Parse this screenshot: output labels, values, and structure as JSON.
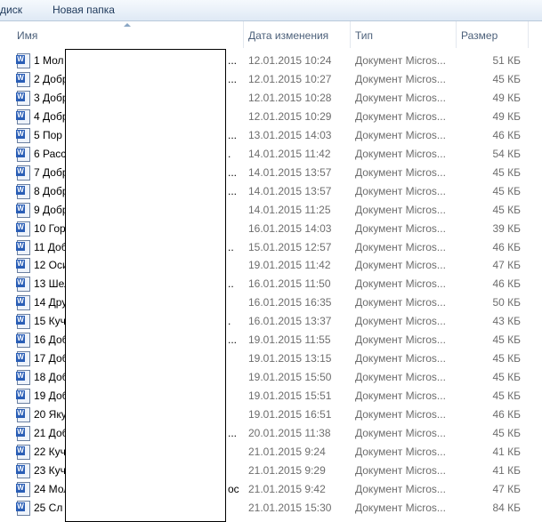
{
  "toolbar": {
    "drive_label": "диск",
    "new_folder_label": "Новая папка"
  },
  "columns": {
    "name": "Имя",
    "date": "Дата изменения",
    "type": "Тип",
    "size": "Размер"
  },
  "files": [
    {
      "name": "1 Мол",
      "suffix": "...",
      "date": "12.01.2015 10:24",
      "type": "Документ Micros...",
      "size": "51 КБ"
    },
    {
      "name": "2 Добр",
      "suffix": "...",
      "date": "12.01.2015 10:27",
      "type": "Документ Micros...",
      "size": "45 КБ"
    },
    {
      "name": "3 Добр",
      "suffix": "",
      "date": "12.01.2015 10:28",
      "type": "Документ Micros...",
      "size": "49 КБ"
    },
    {
      "name": "4 Добр",
      "suffix": "",
      "date": "12.01.2015 10:29",
      "type": "Документ Micros...",
      "size": "49 КБ"
    },
    {
      "name": "5 Пор",
      "suffix": "...",
      "date": "13.01.2015 14:03",
      "type": "Документ Micros...",
      "size": "46 КБ"
    },
    {
      "name": "6 Расс",
      "suffix": ".",
      "date": "14.01.2015 11:42",
      "type": "Документ Micros...",
      "size": "54 КБ"
    },
    {
      "name": "7 Добр",
      "suffix": "...",
      "date": "14.01.2015 13:57",
      "type": "Документ Micros...",
      "size": "45 КБ"
    },
    {
      "name": "8 Добр",
      "suffix": "...",
      "date": "14.01.2015 13:57",
      "type": "Документ Micros...",
      "size": "45 КБ"
    },
    {
      "name": "9 Добр",
      "suffix": "",
      "date": "14.01.2015 11:25",
      "type": "Документ Micros...",
      "size": "45 КБ"
    },
    {
      "name": "10 Гор",
      "suffix": "",
      "date": "16.01.2015 14:03",
      "type": "Документ Micros...",
      "size": "39 КБ"
    },
    {
      "name": "11 Доб",
      "suffix": "..",
      "date": "15.01.2015 12:57",
      "type": "Документ Micros...",
      "size": "46 КБ"
    },
    {
      "name": "12 Оси",
      "suffix": "",
      "date": "19.01.2015 11:42",
      "type": "Документ Micros...",
      "size": "47 КБ"
    },
    {
      "name": "13 Шел",
      "suffix": "..",
      "date": "16.01.2015 11:50",
      "type": "Документ Micros...",
      "size": "46 КБ"
    },
    {
      "name": "14 Дру",
      "suffix": "",
      "date": "16.01.2015 16:35",
      "type": "Документ Micros...",
      "size": "50 КБ"
    },
    {
      "name": "15 Куч",
      "suffix": ".",
      "date": "16.01.2015 13:37",
      "type": "Документ Micros...",
      "size": "43 КБ"
    },
    {
      "name": "16 Доб",
      "suffix": "...",
      "date": "19.01.2015 11:55",
      "type": "Документ Micros...",
      "size": "45 КБ"
    },
    {
      "name": "17 Доб",
      "suffix": "",
      "date": "19.01.2015 13:15",
      "type": "Документ Micros...",
      "size": "45 КБ"
    },
    {
      "name": "18 Доб",
      "suffix": "",
      "date": "19.01.2015 15:50",
      "type": "Документ Micros...",
      "size": "45 КБ"
    },
    {
      "name": "19 Доб",
      "suffix": "",
      "date": "19.01.2015 15:51",
      "type": "Документ Micros...",
      "size": "45 КБ"
    },
    {
      "name": "20 Яку",
      "suffix": "",
      "date": "19.01.2015 16:51",
      "type": "Документ Micros...",
      "size": "46 КБ"
    },
    {
      "name": "21 Доб",
      "suffix": "...",
      "date": "20.01.2015 11:38",
      "type": "Документ Micros...",
      "size": "45 КБ"
    },
    {
      "name": "22 Куч",
      "suffix": "",
      "date": "21.01.2015 9:24",
      "type": "Документ Micros...",
      "size": "41 КБ"
    },
    {
      "name": "23 Куч",
      "suffix": "",
      "date": "21.01.2015 9:29",
      "type": "Документ Micros...",
      "size": "41 КБ"
    },
    {
      "name": "24 Мол",
      "suffix": "ос",
      "date": "21.01.2015 9:42",
      "type": "Документ Micros...",
      "size": "47 КБ"
    },
    {
      "name": "25 Сл",
      "suffix": "",
      "date": "21.01.2015 15:30",
      "type": "Документ Micros...",
      "size": "84 КБ"
    }
  ]
}
